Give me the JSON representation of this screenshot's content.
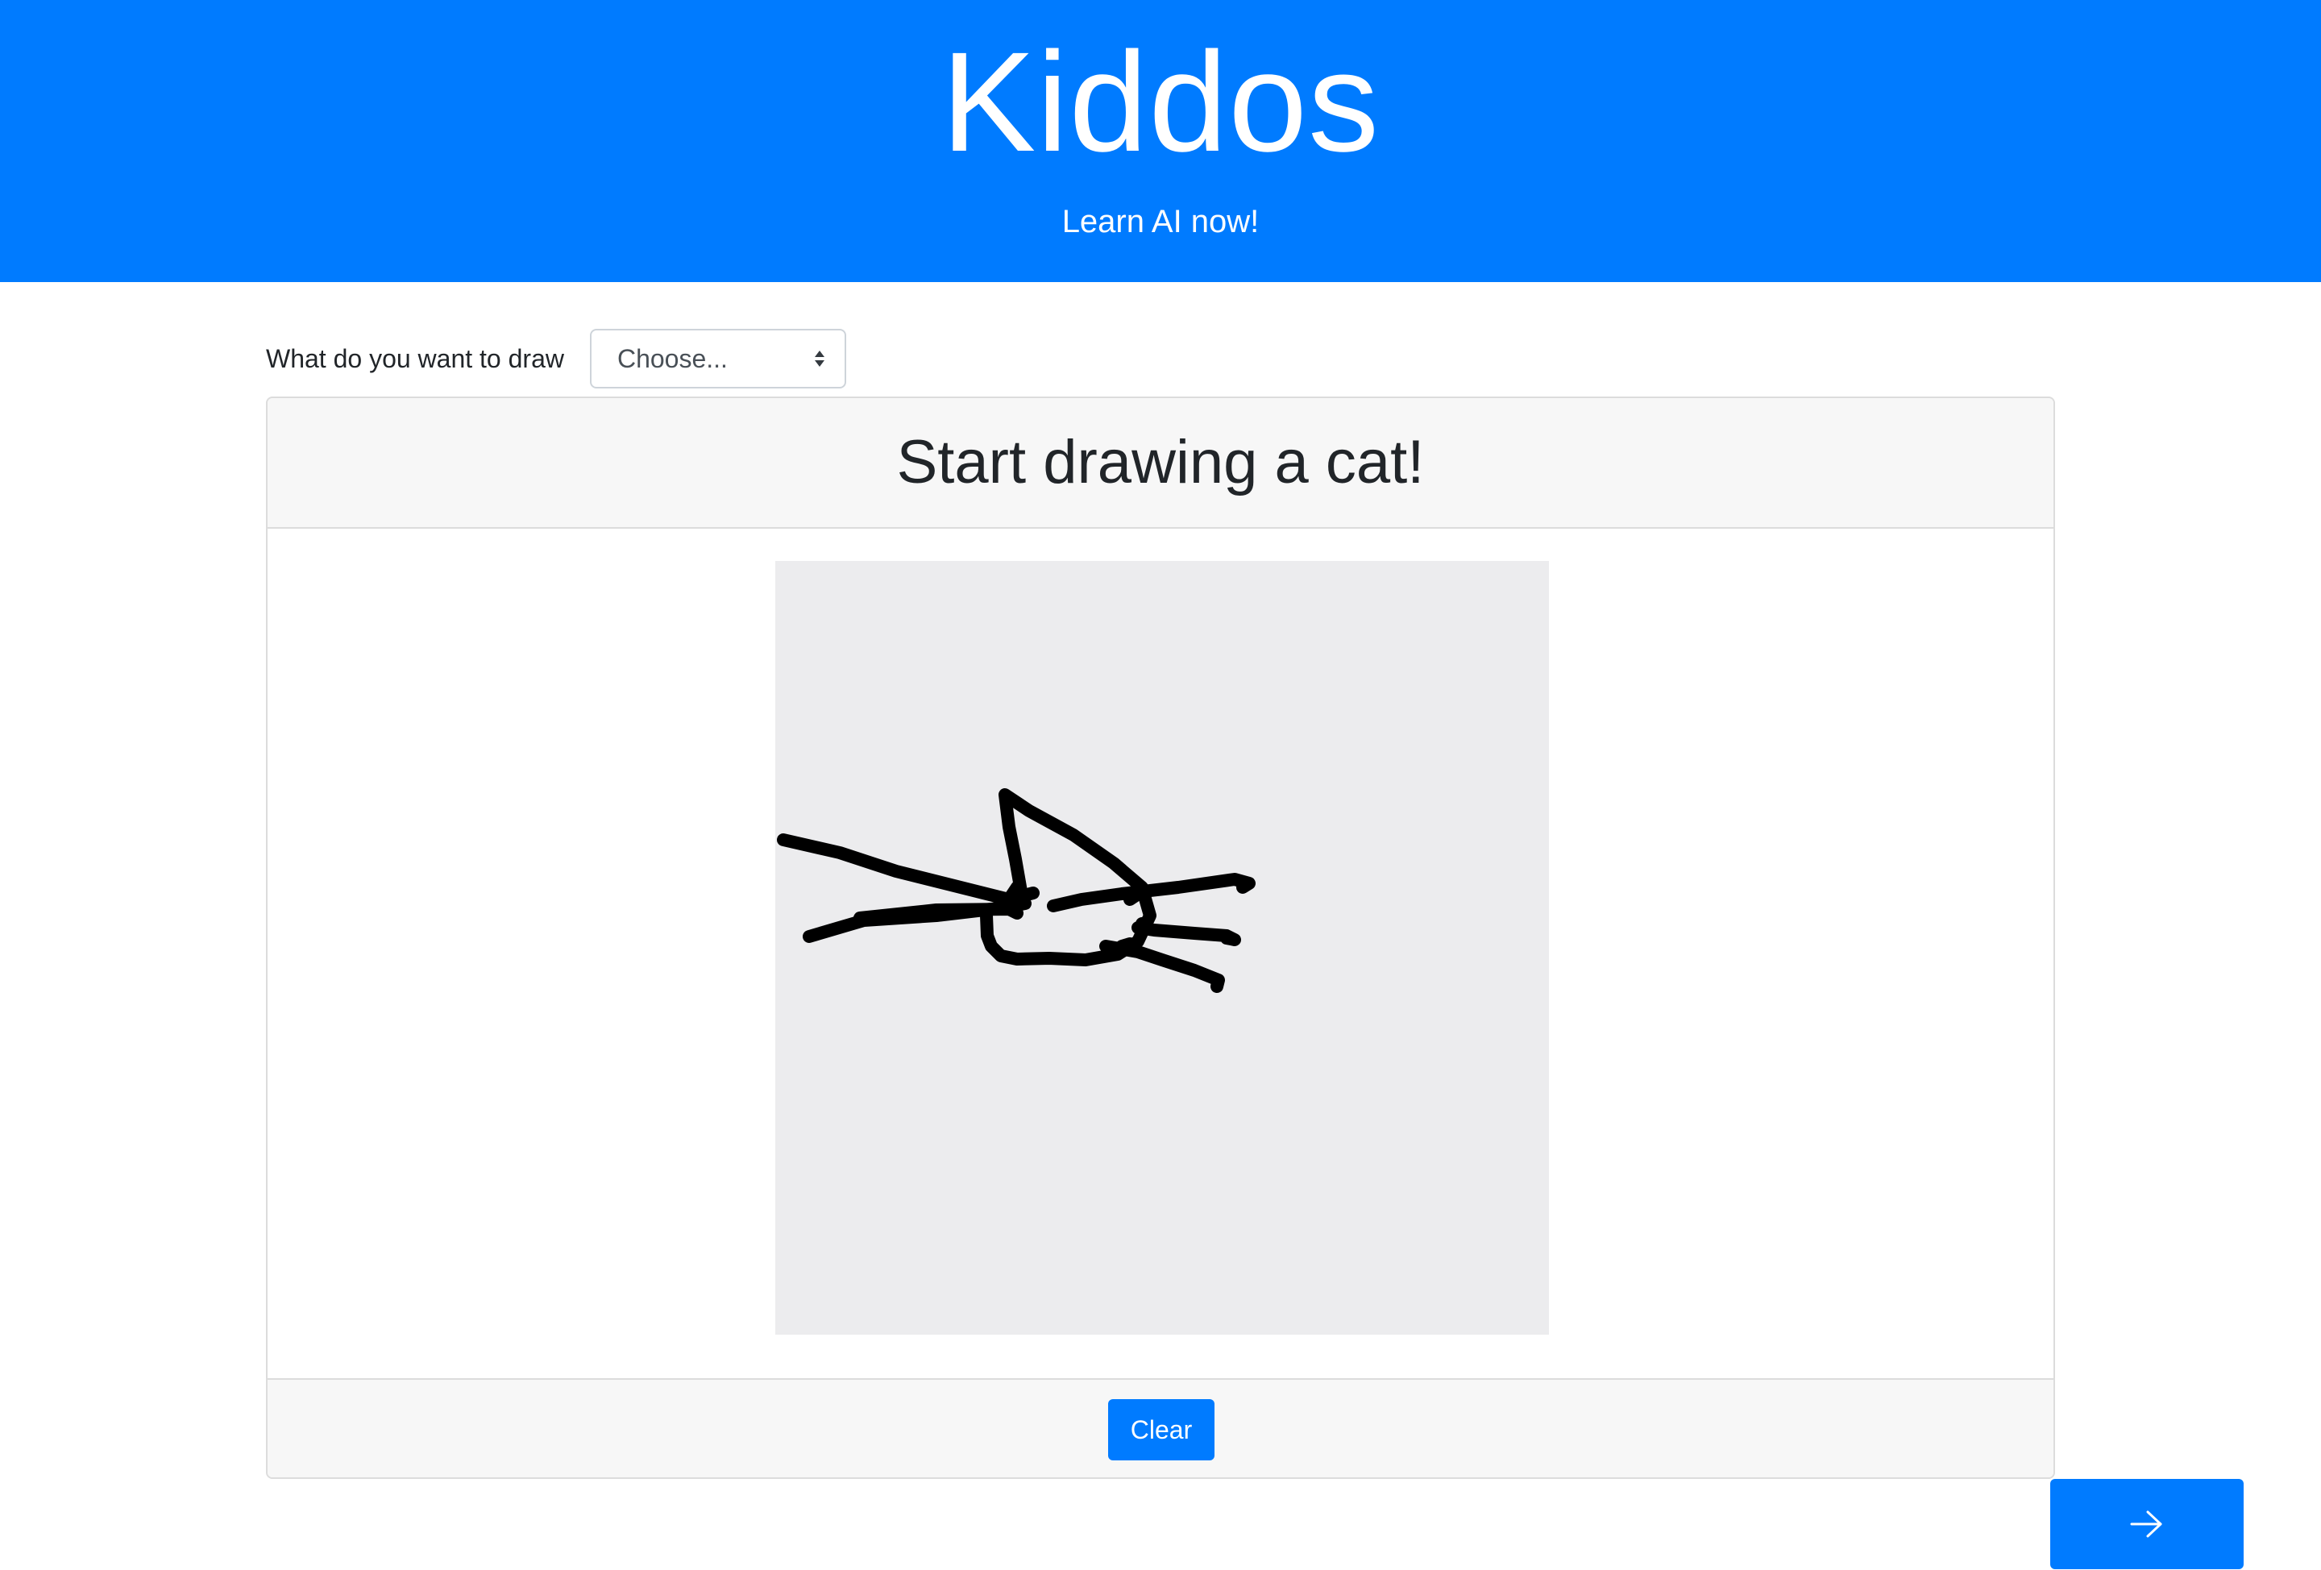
{
  "header": {
    "title": "Kiddos",
    "subtitle": "Learn AI now!"
  },
  "picker": {
    "label": "What do you want to draw",
    "selected": "Choose..."
  },
  "card": {
    "title": "Start drawing a cat!",
    "clear_label": "Clear"
  },
  "nav": {
    "next_icon": "arrow-right-icon"
  },
  "colors": {
    "primary": "#007bff",
    "canvas_bg": "#ececee",
    "stroke": "#000000"
  }
}
